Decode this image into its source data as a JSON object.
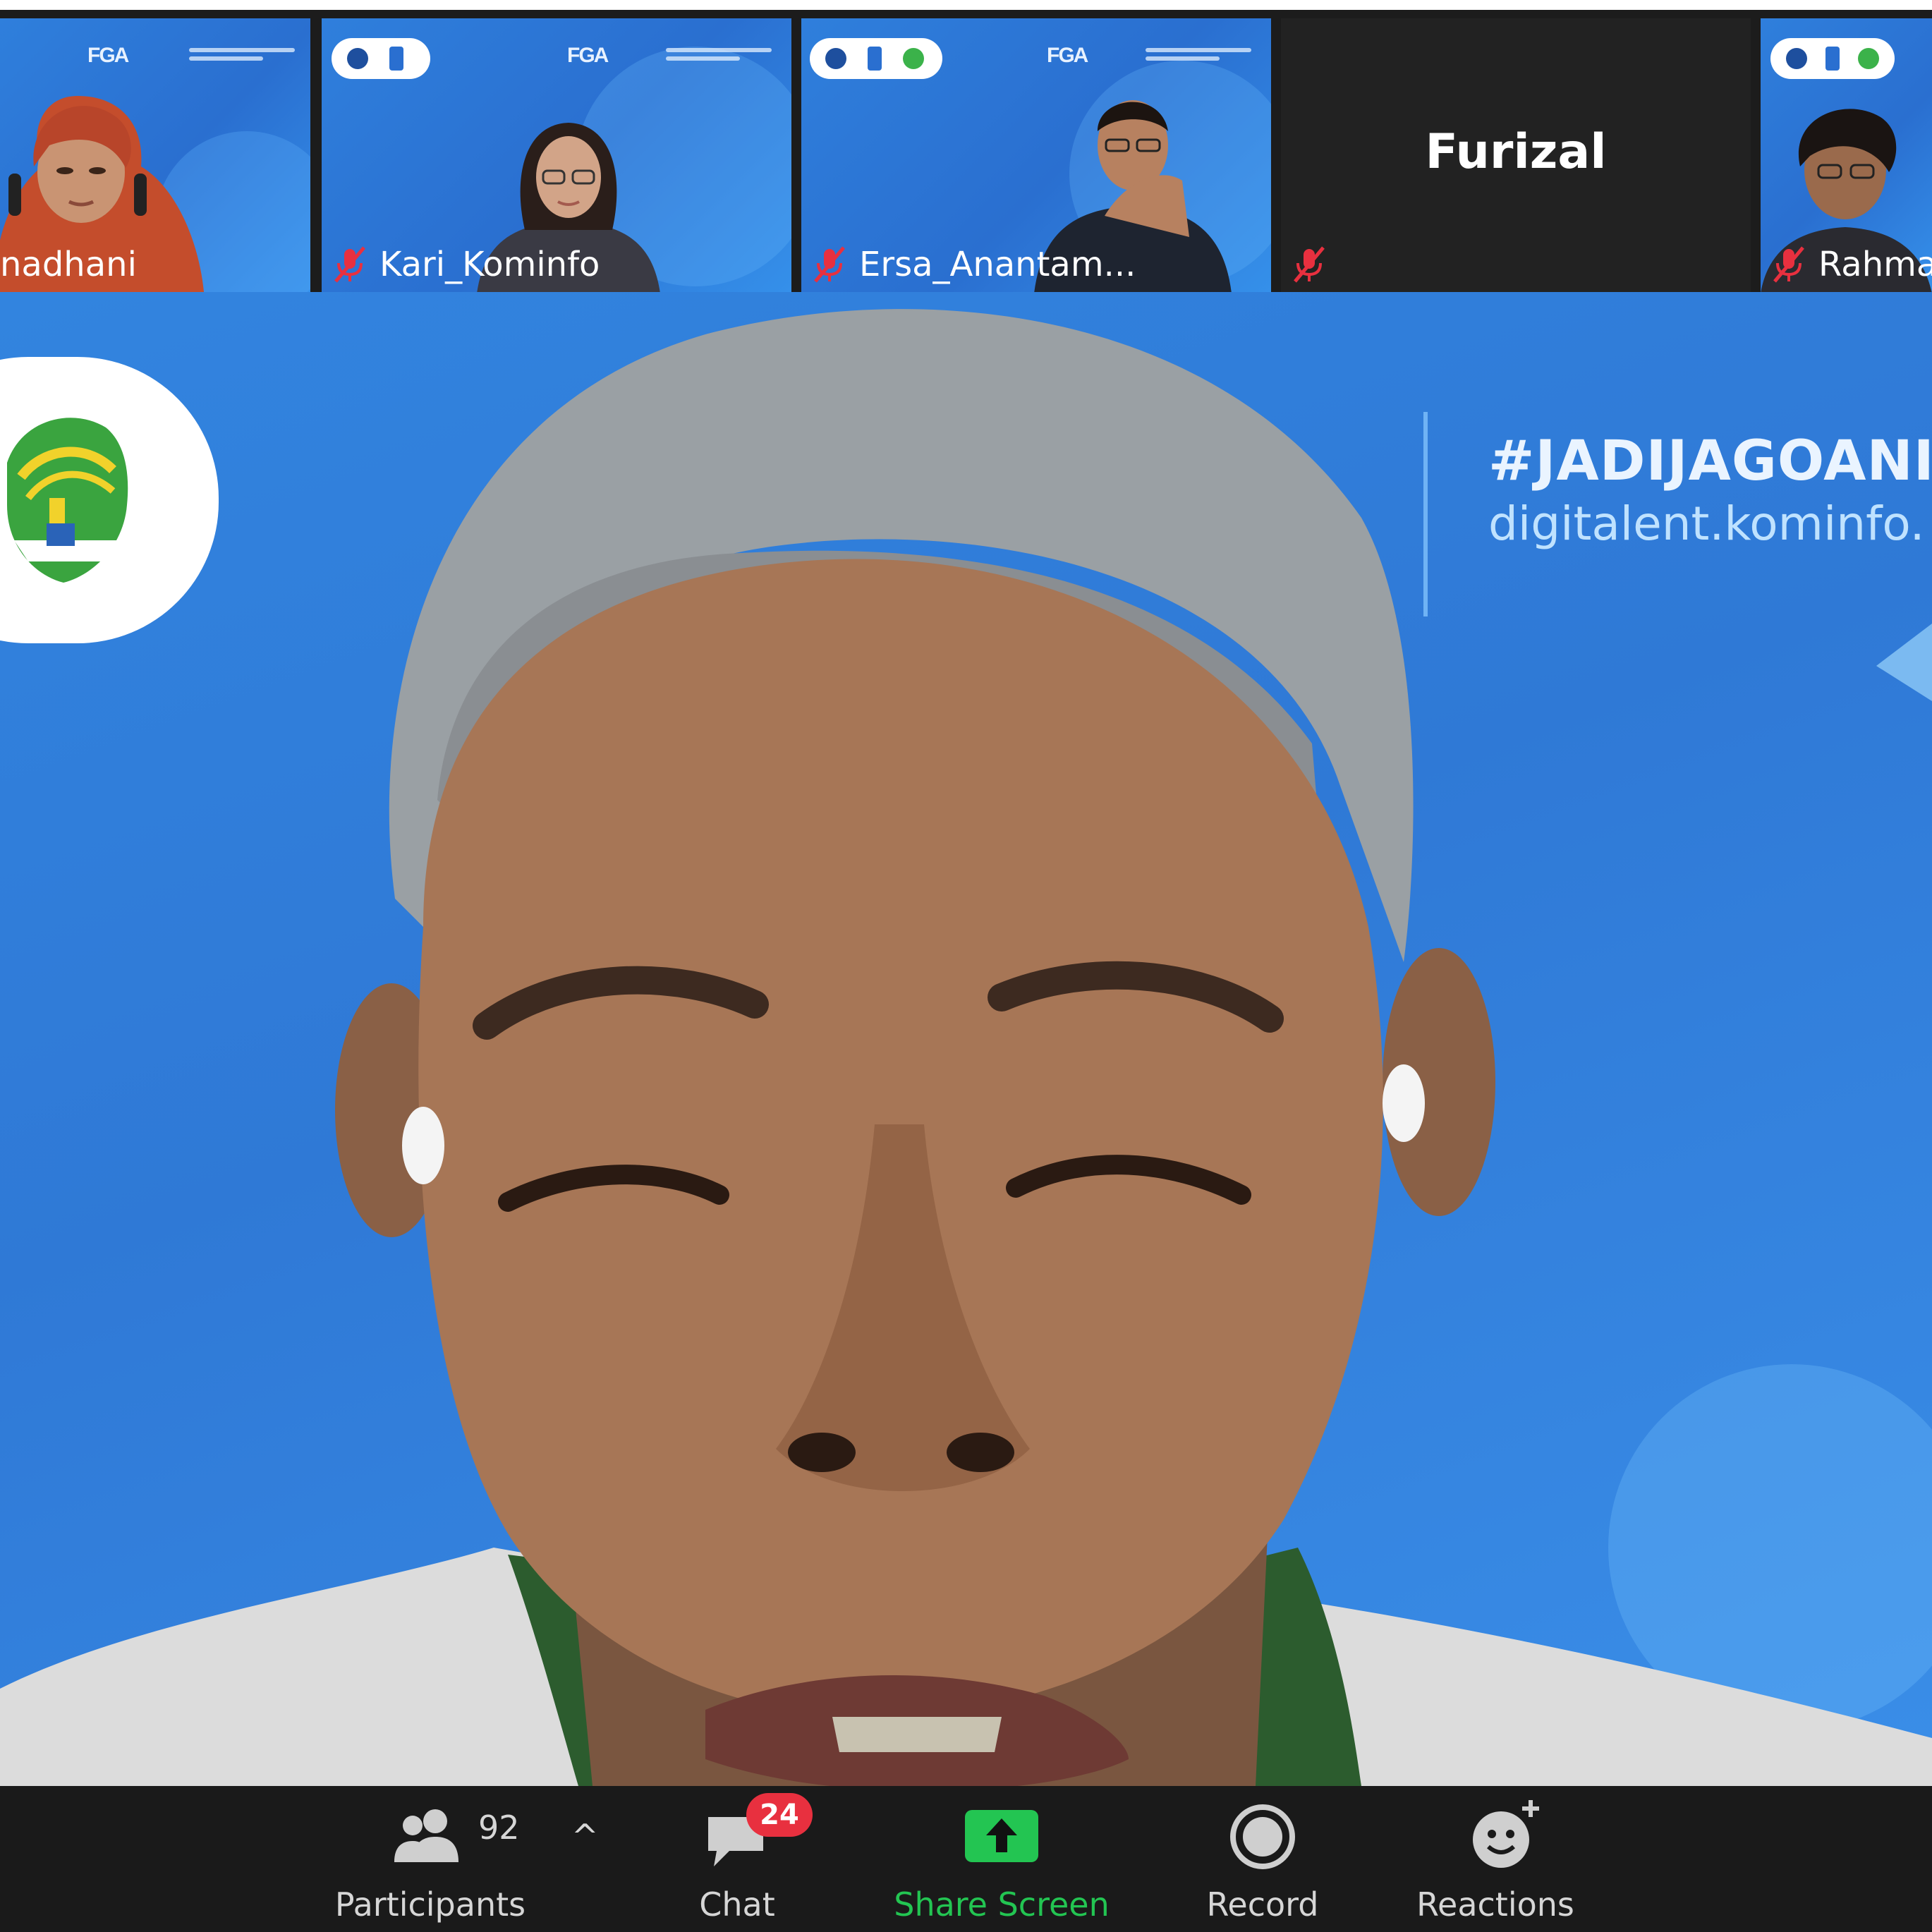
{
  "participants_strip": [
    {
      "name": "nadhani",
      "muted": false
    },
    {
      "name": "Kari_Kominfo",
      "muted": true,
      "banner": "FGA"
    },
    {
      "name": "Ersa_Anantam...",
      "muted": true,
      "banner": "FGA"
    },
    {
      "name": "Furizal",
      "muted": true,
      "video": false
    },
    {
      "name": "Rahma",
      "muted": true
    }
  ],
  "first_tile_banner": "FGA",
  "main_video": {
    "hashtag": "#JADIJAGOANI",
    "url": "digitalent.kominfo."
  },
  "toolbar": {
    "participants_label": "Participants",
    "participants_count": "92",
    "caret": "^",
    "chat_label": "Chat",
    "chat_badge": "24",
    "share_label": "Share Screen",
    "record_label": "Record",
    "reactions_label": "Reactions"
  },
  "colors": {
    "share_accent": "#23c552",
    "badge_red": "#e8303f",
    "toolbar_bg": "#1a1a1a",
    "mute_red": "#e8303f",
    "backdrop_blue": "#2f79d6"
  },
  "icons": [
    "participants-icon",
    "chevron-up-icon",
    "chat-icon",
    "share-screen-icon",
    "record-icon",
    "reactions-icon",
    "mic-muted-icon"
  ]
}
